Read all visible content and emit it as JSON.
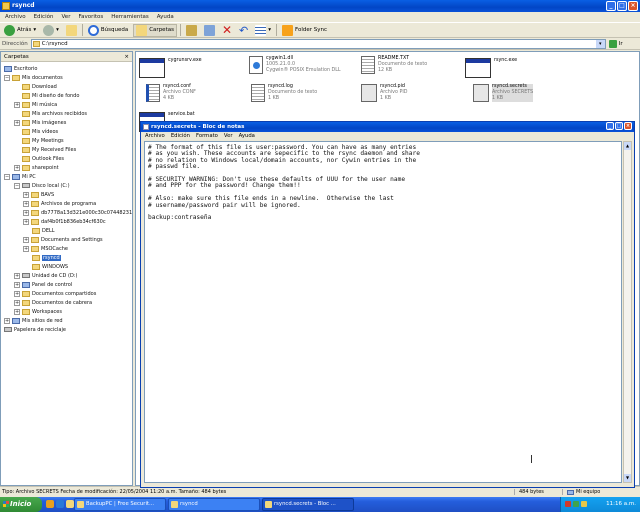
{
  "window": {
    "title": "rsyncd"
  },
  "menu": [
    "Archivo",
    "Edición",
    "Ver",
    "Favoritos",
    "Herramientas",
    "Ayuda"
  ],
  "toolbar": {
    "back": "Atrás",
    "search": "Búsqueda",
    "folders": "Carpetas",
    "folder_sync": "Folder Sync"
  },
  "address": {
    "label": "Dirección",
    "value": "C:\\rsyncd",
    "go": "Ir"
  },
  "folders_panel": {
    "title": "Carpetas",
    "items": [
      "Escritorio",
      "Mis documentos",
      "Download",
      "Mi diseño de fondo",
      "Mi música",
      "Mis archivos recibidos",
      "Mis imágenes",
      "Mis vídeos",
      "My Meetings",
      "My Received Files",
      "Outlook Files",
      "sharepoint",
      "Mi PC",
      "Disco local (C:)",
      "BAVS",
      "Archivos de programa",
      "db7778a13d321e000c30c074482315",
      "daf4b0f1b836eb34cf630c",
      "DELL",
      "Documents and Settings",
      "MSOCache",
      "rsyncd",
      "WINDOWS",
      "Unidad de CD (D:)",
      "Panel de control",
      "Documentos compartidos",
      "Documentos de cabrera",
      "Workspaces",
      "Mis sitios de red",
      "Papelera de reciclaje"
    ]
  },
  "files": [
    {
      "name": "cygrunsrv.exe",
      "detail1": "",
      "detail2": ""
    },
    {
      "name": "cygwin1.dll",
      "detail1": "1005.21.0.0",
      "detail2": "Cygwin® POSIX Emulation DLL"
    },
    {
      "name": "README.TXT",
      "detail1": "Documento de texto",
      "detail2": "12 KB"
    },
    {
      "name": "rsync.exe",
      "detail1": "",
      "detail2": ""
    },
    {
      "name": "rsyncd.conf",
      "detail1": "Archivo CONF",
      "detail2": "4 KB"
    },
    {
      "name": "rsyncd.log",
      "detail1": "Documento de texto",
      "detail2": "1 KB"
    },
    {
      "name": "rsyncd.pid",
      "detail1": "Archivo PID",
      "detail2": "1 KB"
    },
    {
      "name": "rsyncd.secrets",
      "detail1": "Archivo SECRETS",
      "detail2": "1 KB"
    },
    {
      "name": "service.bat",
      "detail1": "",
      "detail2": ""
    }
  ],
  "notepad": {
    "title": "rsyncd.secrets - Bloc de notas",
    "menu": [
      "Archivo",
      "Edición",
      "Formato",
      "Ver",
      "Ayuda"
    ],
    "content": "# The format of this file is user:password. You can have as many entries\n# as you wish. These accounts are sepecific to the rsync daemon and share\n# no relation to Windows local/domain accounts, nor Cywin entries in the\n# passwd file.\n\n# SECURITY WARNING: Don't use these defaults of UUU for the user name\n# and PPP for the password! Change them!!\n\n# Also: make sure this file ends in a newline.  Otherwise the last\n# username/password pair will be ignored.\n\nbackup:contraseña"
  },
  "status": {
    "info": "Tipo: Archivo SECRETS Fecha de modificación: 22/05/2004 11:20 a.m. Tamaño: 484 bytes",
    "size": "484 bytes",
    "location": "Mi equipo"
  },
  "taskbar": {
    "start": "Inicio",
    "tasks": [
      "BackupPC | Free Securit...",
      "rsyncd",
      "rsyncd.secrets - Bloc ..."
    ],
    "clock": "11:16 a.m."
  }
}
